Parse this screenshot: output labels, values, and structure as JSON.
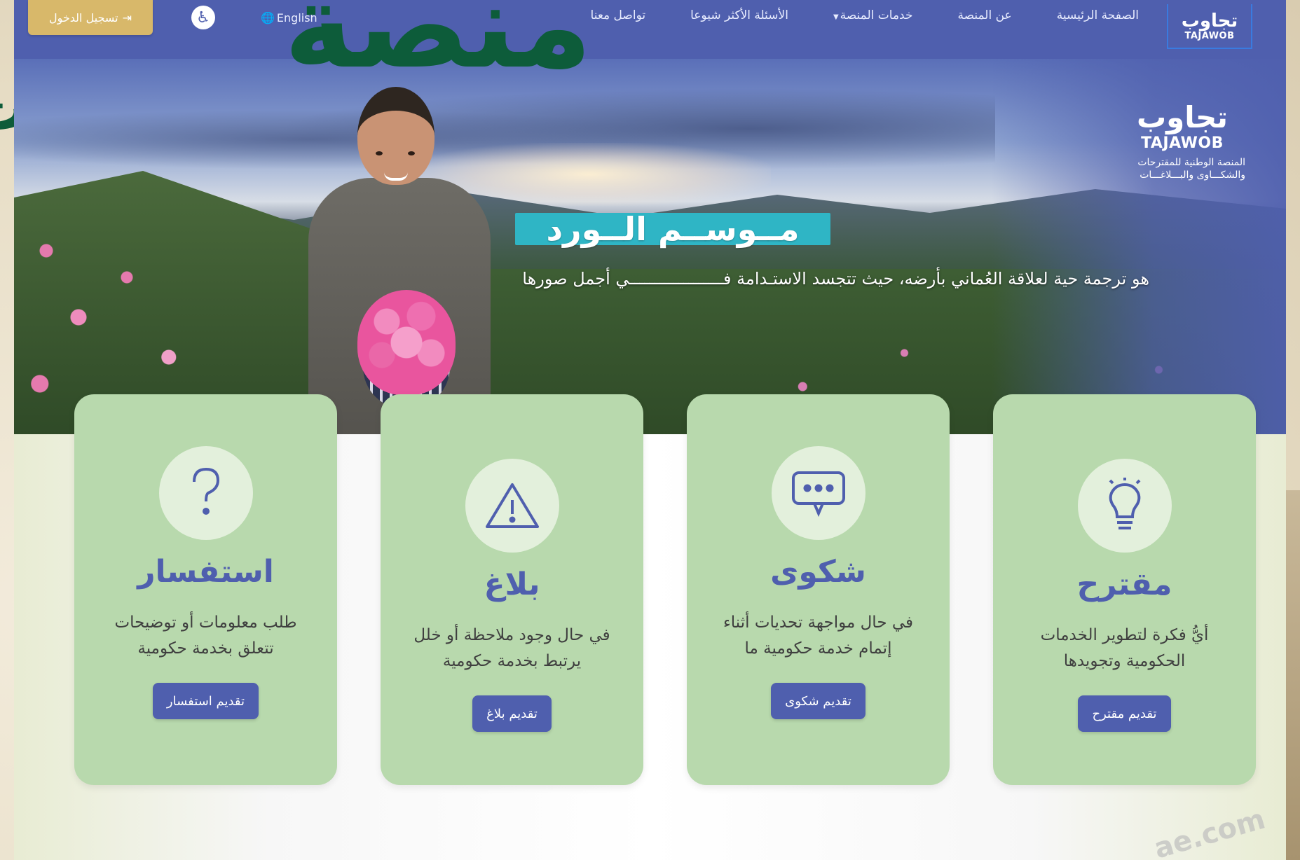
{
  "overlay": {
    "title": "منصة"
  },
  "nav": {
    "logo_ar": "تجاوب",
    "logo_en": "TAJAWOB",
    "links": [
      "الصفحة الرئيسية",
      "عن المنصة",
      "خدمات المنصة",
      "الأسئلة الأكثر شيوعا",
      "تواصل معنا"
    ],
    "language": "English",
    "login": "تسجيل الدخول"
  },
  "hero": {
    "brand_ar": "تجاوب",
    "brand_en": "TAJAWOB",
    "brand_sub_1": "المنصة الوطنية للمقترحات",
    "brand_sub_2": "والشكـــاوى والبـــلاغـــات",
    "title": "مــوســم الــورد",
    "tagline": "هو ترجمة حية لعلاقة العُماني بأرضه، حيث تتجسد الاستـدامة فـــــــــــــــــــي أجمل صورها"
  },
  "cards": [
    {
      "title": "مقترح",
      "desc": "أيُّ فكرة لتطوير الخدمات الحكومية وتجويدها",
      "button": "تقديم مقترح",
      "icon": "lightbulb-icon"
    },
    {
      "title": "شكوى",
      "desc": "في حال مواجهة تحديات أثناء إتمام خدمة حكومية ما",
      "button": "تقديم شكوى",
      "icon": "chat-bubble-icon"
    },
    {
      "title": "بلاغ",
      "desc": "في حال وجود ملاحظة أو خلل يرتبط بخدمة حكومية",
      "button": "تقديم بلاغ",
      "icon": "warning-icon"
    },
    {
      "title": "استفسار",
      "desc": "طلب معلومات أو توضيحات تتعلق بخدمة حكومية",
      "button": "تقديم استفسار",
      "icon": "question-icon"
    }
  ],
  "watermark": "ae.com",
  "colors": {
    "primary": "#4f5fae",
    "card": "#b8d9ad",
    "accent": "#2fb5c5",
    "login": "#d8b86a",
    "overlay": "#0d5c3a"
  }
}
